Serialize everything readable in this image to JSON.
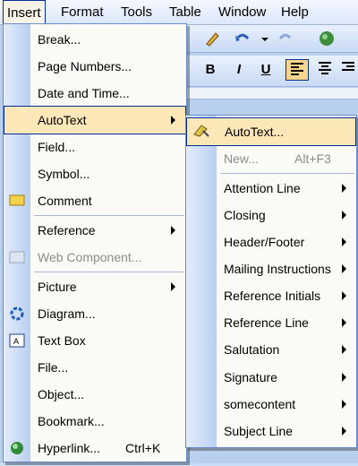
{
  "menubar": {
    "items": [
      "Insert",
      "Format",
      "Tools",
      "Table",
      "Window",
      "Help"
    ]
  },
  "format_bar": {
    "bold": "B",
    "italic": "I",
    "underline": "U"
  },
  "insert_menu": {
    "items": [
      {
        "label": "Break...",
        "shortcut": ""
      },
      {
        "label": "Page Numbers...",
        "shortcut": ""
      },
      {
        "label": "Date and Time...",
        "shortcut": ""
      },
      {
        "label": "AutoText",
        "shortcut": ""
      },
      {
        "label": "Field...",
        "shortcut": ""
      },
      {
        "label": "Symbol...",
        "shortcut": ""
      },
      {
        "label": "Comment",
        "shortcut": ""
      },
      {
        "label": "Reference",
        "shortcut": ""
      },
      {
        "label": "Web Component...",
        "shortcut": ""
      },
      {
        "label": "Picture",
        "shortcut": ""
      },
      {
        "label": "Diagram...",
        "shortcut": ""
      },
      {
        "label": "Text Box",
        "shortcut": ""
      },
      {
        "label": "File...",
        "shortcut": ""
      },
      {
        "label": "Object...",
        "shortcut": ""
      },
      {
        "label": "Bookmark...",
        "shortcut": ""
      },
      {
        "label": "Hyperlink...",
        "shortcut": "Ctrl+K"
      }
    ]
  },
  "autotext_menu": {
    "items": [
      {
        "label": "AutoText...",
        "shortcut": ""
      },
      {
        "label": "New...",
        "shortcut": "Alt+F3"
      },
      {
        "label": "Attention Line",
        "shortcut": ""
      },
      {
        "label": "Closing",
        "shortcut": ""
      },
      {
        "label": "Header/Footer",
        "shortcut": ""
      },
      {
        "label": "Mailing Instructions",
        "shortcut": ""
      },
      {
        "label": "Reference Initials",
        "shortcut": ""
      },
      {
        "label": "Reference Line",
        "shortcut": ""
      },
      {
        "label": "Salutation",
        "shortcut": ""
      },
      {
        "label": "Signature",
        "shortcut": ""
      },
      {
        "label": "somecontent",
        "shortcut": ""
      },
      {
        "label": "Subject Line",
        "shortcut": ""
      }
    ]
  },
  "colors": {
    "highlight": "#fce7b8",
    "highlight_border": "#002d96",
    "gutter": "#c7d9f5"
  }
}
